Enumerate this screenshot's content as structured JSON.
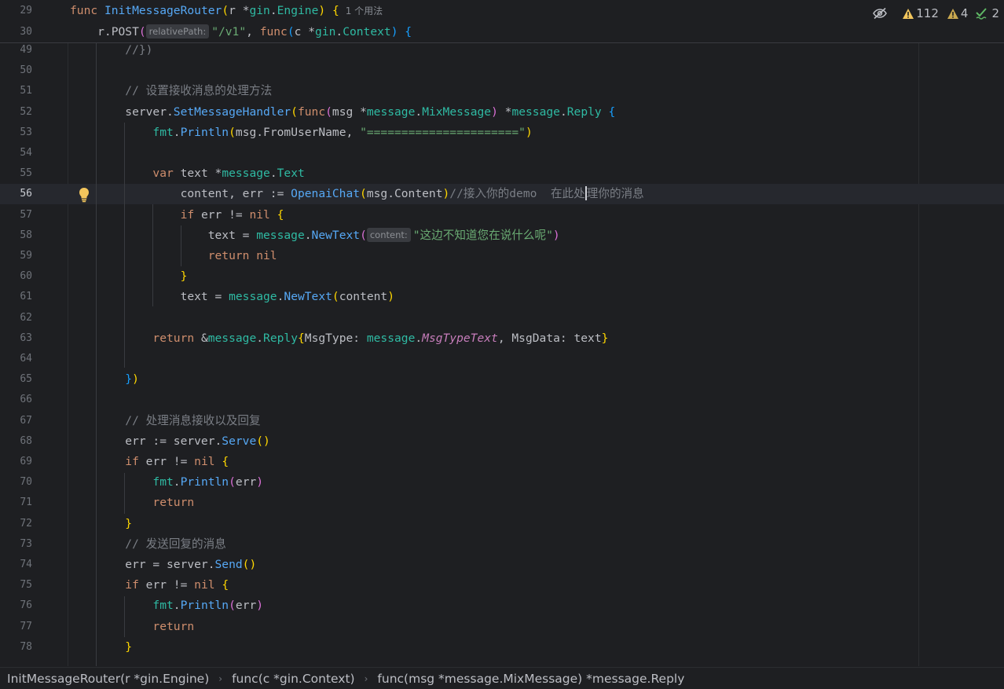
{
  "editor": {
    "sticky": [
      {
        "num": "29",
        "segments": [
          {
            "t": "func ",
            "c": "kw"
          },
          {
            "t": "InitMessageRouter",
            "c": "fn"
          },
          {
            "t": "(",
            "c": "br1"
          },
          {
            "t": "r ",
            "c": "id"
          },
          {
            "t": "*",
            "c": "id"
          },
          {
            "t": "gin",
            "c": "typ"
          },
          {
            "t": ".",
            "c": "id"
          },
          {
            "t": "Engine",
            "c": "typ"
          },
          {
            "t": ") ",
            "c": "br1"
          },
          {
            "t": "{",
            "c": "br1"
          }
        ],
        "usage": "1 个用法"
      },
      {
        "num": "30",
        "segments": [
          {
            "t": "    r.",
            "c": "id"
          },
          {
            "t": "POST",
            "c": "id"
          },
          {
            "t": "(",
            "c": "br2"
          },
          {
            "t": "relativePath:",
            "c": "hint"
          },
          {
            "t": "\"/v1\"",
            "c": "str"
          },
          {
            "t": ", ",
            "c": "id"
          },
          {
            "t": "func",
            "c": "kw"
          },
          {
            "t": "(",
            "c": "br3"
          },
          {
            "t": "c ",
            "c": "id"
          },
          {
            "t": "*",
            "c": "id"
          },
          {
            "t": "gin",
            "c": "typ"
          },
          {
            "t": ".",
            "c": "id"
          },
          {
            "t": "Context",
            "c": "typ"
          },
          {
            "t": ") ",
            "c": "br3"
          },
          {
            "t": "{",
            "c": "br3"
          }
        ]
      }
    ],
    "lines": [
      {
        "num": "49",
        "segments": [
          {
            "t": "        //})",
            "c": "com"
          }
        ]
      },
      {
        "num": "50",
        "segments": []
      },
      {
        "num": "51",
        "segments": [
          {
            "t": "        // 设置接收消息的处理方法",
            "c": "com"
          }
        ]
      },
      {
        "num": "52",
        "segments": [
          {
            "t": "        server.",
            "c": "id"
          },
          {
            "t": "SetMessageHandler",
            "c": "fn"
          },
          {
            "t": "(",
            "c": "br1"
          },
          {
            "t": "func",
            "c": "kw"
          },
          {
            "t": "(",
            "c": "br2"
          },
          {
            "t": "msg ",
            "c": "id"
          },
          {
            "t": "*",
            "c": "id"
          },
          {
            "t": "message",
            "c": "typ"
          },
          {
            "t": ".",
            "c": "id"
          },
          {
            "t": "MixMessage",
            "c": "typ"
          },
          {
            "t": ") ",
            "c": "br2"
          },
          {
            "t": "*",
            "c": "id"
          },
          {
            "t": "message",
            "c": "typ"
          },
          {
            "t": ".",
            "c": "id"
          },
          {
            "t": "Reply ",
            "c": "typ"
          },
          {
            "t": "{",
            "c": "br3"
          }
        ]
      },
      {
        "num": "53",
        "segments": [
          {
            "t": "            fmt",
            "c": "typ"
          },
          {
            "t": ".",
            "c": "id"
          },
          {
            "t": "Println",
            "c": "fn"
          },
          {
            "t": "(",
            "c": "br1"
          },
          {
            "t": "msg.FromUserName, ",
            "c": "id"
          },
          {
            "t": "\"======================\"",
            "c": "str"
          },
          {
            "t": ")",
            "c": "br1"
          }
        ]
      },
      {
        "num": "54",
        "segments": []
      },
      {
        "num": "55",
        "segments": [
          {
            "t": "            var ",
            "c": "kw"
          },
          {
            "t": "text ",
            "c": "id"
          },
          {
            "t": "*",
            "c": "id"
          },
          {
            "t": "message",
            "c": "typ"
          },
          {
            "t": ".",
            "c": "id"
          },
          {
            "t": "Text",
            "c": "typ"
          }
        ]
      },
      {
        "num": "56",
        "current": true,
        "segments": [
          {
            "t": "                content, err := ",
            "c": "id"
          },
          {
            "t": "OpenaiChat",
            "c": "fn"
          },
          {
            "t": "(",
            "c": "br1"
          },
          {
            "t": "msg.Content",
            "c": "id"
          },
          {
            "t": ")",
            "c": "br1"
          },
          {
            "t": "//接入你的demo  在此处",
            "c": "com"
          },
          {
            "t": "",
            "c": "caret"
          },
          {
            "t": "理你的消息",
            "c": "com"
          }
        ]
      },
      {
        "num": "57",
        "segments": [
          {
            "t": "                if ",
            "c": "kw"
          },
          {
            "t": "err != ",
            "c": "id"
          },
          {
            "t": "nil ",
            "c": "kw"
          },
          {
            "t": "{",
            "c": "br1"
          }
        ]
      },
      {
        "num": "58",
        "segments": [
          {
            "t": "                    text = ",
            "c": "id"
          },
          {
            "t": "message",
            "c": "typ"
          },
          {
            "t": ".",
            "c": "id"
          },
          {
            "t": "NewText",
            "c": "fn"
          },
          {
            "t": "(",
            "c": "br2"
          },
          {
            "t": "content:",
            "c": "hint"
          },
          {
            "t": "\"这边不知道您在说什么呢\"",
            "c": "str"
          },
          {
            "t": ")",
            "c": "br2"
          }
        ]
      },
      {
        "num": "59",
        "segments": [
          {
            "t": "                    return ",
            "c": "kw"
          },
          {
            "t": "nil",
            "c": "kw"
          }
        ]
      },
      {
        "num": "60",
        "segments": [
          {
            "t": "                }",
            "c": "br1"
          }
        ]
      },
      {
        "num": "61",
        "segments": [
          {
            "t": "                text = ",
            "c": "id"
          },
          {
            "t": "message",
            "c": "typ"
          },
          {
            "t": ".",
            "c": "id"
          },
          {
            "t": "NewText",
            "c": "fn"
          },
          {
            "t": "(",
            "c": "br1"
          },
          {
            "t": "content",
            "c": "id"
          },
          {
            "t": ")",
            "c": "br1"
          }
        ]
      },
      {
        "num": "62",
        "segments": []
      },
      {
        "num": "63",
        "segments": [
          {
            "t": "            return ",
            "c": "kw"
          },
          {
            "t": "&",
            "c": "id"
          },
          {
            "t": "message",
            "c": "typ"
          },
          {
            "t": ".",
            "c": "id"
          },
          {
            "t": "Reply",
            "c": "typ"
          },
          {
            "t": "{",
            "c": "br1"
          },
          {
            "t": "MsgType: ",
            "c": "id"
          },
          {
            "t": "message",
            "c": "typ"
          },
          {
            "t": ".",
            "c": "id"
          },
          {
            "t": "MsgTypeText",
            "c": "con"
          },
          {
            "t": ", MsgData: text",
            "c": "id"
          },
          {
            "t": "}",
            "c": "br1"
          }
        ]
      },
      {
        "num": "64",
        "segments": []
      },
      {
        "num": "65",
        "segments": [
          {
            "t": "        }",
            "c": "br3"
          },
          {
            "t": ")",
            "c": "br1"
          }
        ]
      },
      {
        "num": "66",
        "segments": []
      },
      {
        "num": "67",
        "segments": [
          {
            "t": "        // 处理消息接收以及回复",
            "c": "com"
          }
        ]
      },
      {
        "num": "68",
        "segments": [
          {
            "t": "        err := server.",
            "c": "id"
          },
          {
            "t": "Serve",
            "c": "fn"
          },
          {
            "t": "()",
            "c": "br1"
          }
        ]
      },
      {
        "num": "69",
        "segments": [
          {
            "t": "        if ",
            "c": "kw"
          },
          {
            "t": "err != ",
            "c": "id"
          },
          {
            "t": "nil ",
            "c": "kw"
          },
          {
            "t": "{",
            "c": "br1"
          }
        ]
      },
      {
        "num": "70",
        "segments": [
          {
            "t": "            fmt",
            "c": "typ"
          },
          {
            "t": ".",
            "c": "id"
          },
          {
            "t": "Println",
            "c": "fn"
          },
          {
            "t": "(",
            "c": "br2"
          },
          {
            "t": "err",
            "c": "id"
          },
          {
            "t": ")",
            "c": "br2"
          }
        ]
      },
      {
        "num": "71",
        "segments": [
          {
            "t": "            return",
            "c": "kw"
          }
        ]
      },
      {
        "num": "72",
        "segments": [
          {
            "t": "        }",
            "c": "br1"
          }
        ]
      },
      {
        "num": "73",
        "segments": [
          {
            "t": "        // 发送回复的消息",
            "c": "com"
          }
        ]
      },
      {
        "num": "74",
        "segments": [
          {
            "t": "        err = server.",
            "c": "id"
          },
          {
            "t": "Send",
            "c": "fn"
          },
          {
            "t": "()",
            "c": "br1"
          }
        ]
      },
      {
        "num": "75",
        "segments": [
          {
            "t": "        if ",
            "c": "kw"
          },
          {
            "t": "err != ",
            "c": "id"
          },
          {
            "t": "nil ",
            "c": "kw"
          },
          {
            "t": "{",
            "c": "br1"
          }
        ]
      },
      {
        "num": "76",
        "segments": [
          {
            "t": "            fmt",
            "c": "typ"
          },
          {
            "t": ".",
            "c": "id"
          },
          {
            "t": "Println",
            "c": "fn"
          },
          {
            "t": "(",
            "c": "br2"
          },
          {
            "t": "err",
            "c": "id"
          },
          {
            "t": ")",
            "c": "br2"
          }
        ]
      },
      {
        "num": "77",
        "segments": [
          {
            "t": "            return",
            "c": "kw"
          }
        ]
      },
      {
        "num": "78",
        "segments": [
          {
            "t": "        }",
            "c": "br1"
          }
        ]
      }
    ]
  },
  "inspections": {
    "warnings_count": "112",
    "weak_warnings_count": "4",
    "typos_count": "2",
    "warning_color": "#f2c55c",
    "ok_color": "#5fb865"
  },
  "breadcrumb": {
    "items": [
      "InitMessageRouter(r *gin.Engine)",
      "func(c *gin.Context)",
      "func(msg *message.MixMessage) *message.Reply"
    ]
  }
}
